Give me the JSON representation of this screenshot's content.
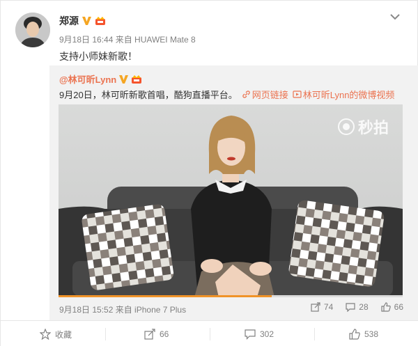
{
  "post": {
    "author": "郑源",
    "meta": "9月18日 16:44 来自 HUAWEI Mate 8",
    "text": "支持小师妹新歌！"
  },
  "repost": {
    "author": "@林可昕Lynn",
    "text": "9月20日，林可昕新歌首唱，酷狗直播平台。",
    "link1": "网页链接",
    "link2": "林可昕Lynn的微博视频",
    "video_watermark": "秒拍",
    "video_progress": 0.62,
    "meta": "9月18日 15:52 来自 iPhone 7 Plus",
    "reposts": "74",
    "comments": "28",
    "likes": "66"
  },
  "actions": {
    "favorite": "收藏",
    "repost": "66",
    "comment": "302",
    "like": "538"
  },
  "colors": {
    "accent": "#eb7350",
    "verified": "#f5a623",
    "progress": "#f09328"
  }
}
